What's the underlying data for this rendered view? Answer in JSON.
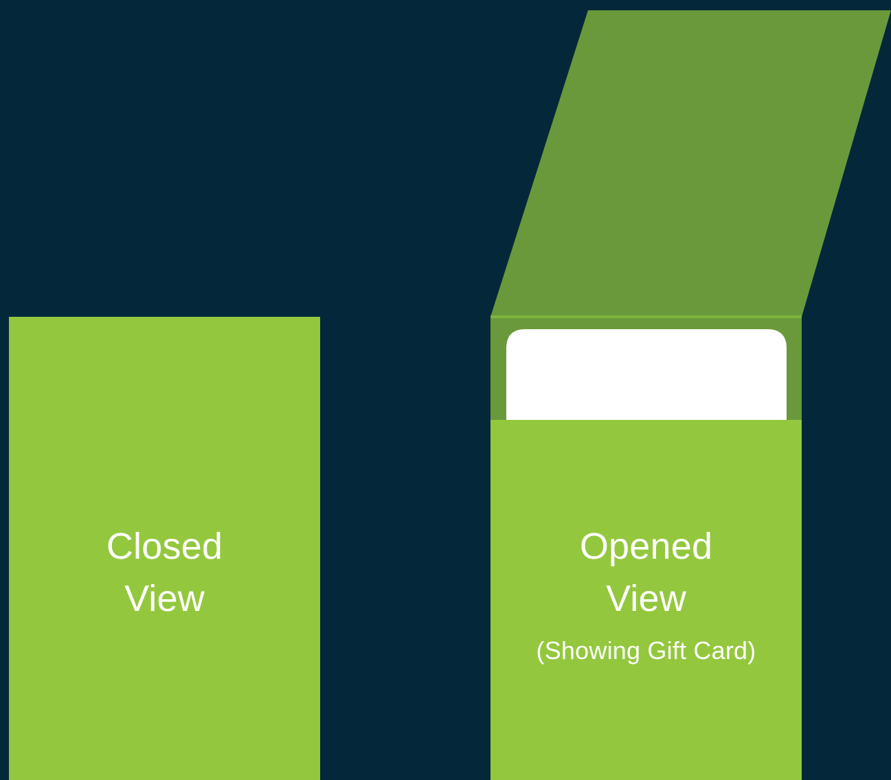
{
  "colors": {
    "background": "#04283A",
    "sleeve_front": "#93C83E",
    "sleeve_back": "#6A993B",
    "sleeve_edge": "#7DB53B",
    "gift_card": "#FFFFFF",
    "text": "#FFFFFF"
  },
  "closed_view": {
    "line1": "Closed",
    "line2": "View"
  },
  "opened_view": {
    "line1": "Opened",
    "line2": "View",
    "subtitle": "(Showing Gift Card)"
  }
}
